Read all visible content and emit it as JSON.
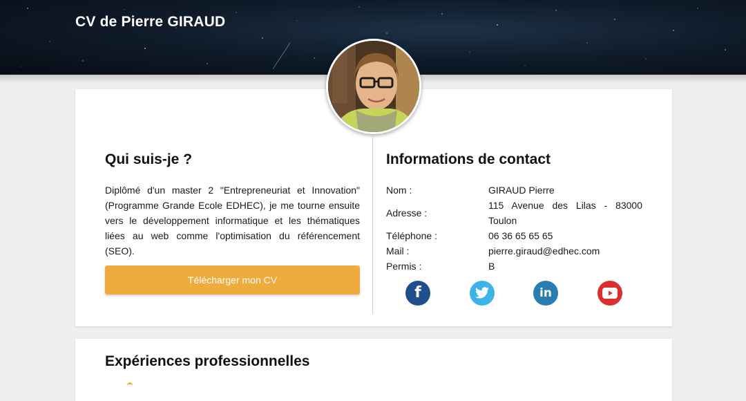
{
  "header": {
    "title": "CV de Pierre GIRAUD"
  },
  "avatar": {
    "icon": "profile-photo"
  },
  "about": {
    "title": "Qui suis-je ?",
    "text": "Diplômé d'un master 2 \"Entrepreneuriat et Innovation\" (Programme Grande Ecole EDHEC), je me tourne ensuite vers le développement informatique et les thématiques liées au web comme l'optimisation du référencement (SEO).",
    "button_label": "Télécharger mon CV"
  },
  "contact": {
    "title": "Informations de contact",
    "name_label": "Nom :",
    "name_value": "GIRAUD Pierre",
    "address_label": "Adresse :",
    "address_value": "115 Avenue des Lilas - 83000 Toulon",
    "phone_label": "Téléphone :",
    "phone_value": "06 36 65 65 65",
    "mail_label": "Mail :",
    "mail_value": "pierre.giraud@edhec.com",
    "license_label": "Permis :",
    "license_value": "B"
  },
  "social": [
    {
      "icon": "facebook-icon",
      "color": "#1e4f8c"
    },
    {
      "icon": "twitter-icon",
      "color": "#3db4e5"
    },
    {
      "icon": "linkedin-icon",
      "color": "#2a7db0"
    },
    {
      "icon": "youtube-icon",
      "color": "#d92f2f"
    }
  ],
  "experience": {
    "title": "Expériences professionnelles"
  },
  "colors": {
    "accent": "#f0ab3f",
    "page_background": "#efefef"
  }
}
